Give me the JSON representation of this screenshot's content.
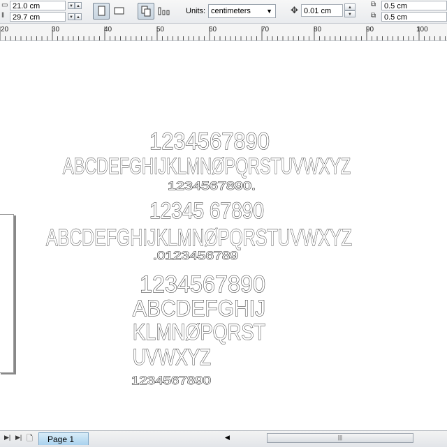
{
  "propbar": {
    "width_value": "21.0 cm",
    "height_value": "29.7 cm",
    "units_label": "Units:",
    "units_value": "centimeters",
    "nudge_value": "0.01 cm",
    "dup_x_value": "0.5 cm",
    "dup_y_value": "0.5 cm"
  },
  "ruler": {
    "ticks": [
      "20",
      "30",
      "40",
      "50",
      "60",
      "70",
      "80",
      "90",
      "100"
    ]
  },
  "artwork": {
    "block1": {
      "digits": "1234567890",
      "alphabet": "ABCDEFGHIJKLMNØPQRSTUVWXYZ",
      "small_digits": "1234567890."
    },
    "block2": {
      "digits": "12345 67890",
      "alphabet": "ABCDEFGHIJKLMNØPQRSTUVWXYZ",
      "small_digits": ".0123456789"
    },
    "block3": {
      "digits": "1234567890",
      "row1": "ABCDEFGHIJ",
      "row2": "KLMNØPQRST",
      "row3": "UVWXYZ",
      "small_digits": "1234567890"
    }
  },
  "statusbar": {
    "page_tab": "Page 1"
  }
}
